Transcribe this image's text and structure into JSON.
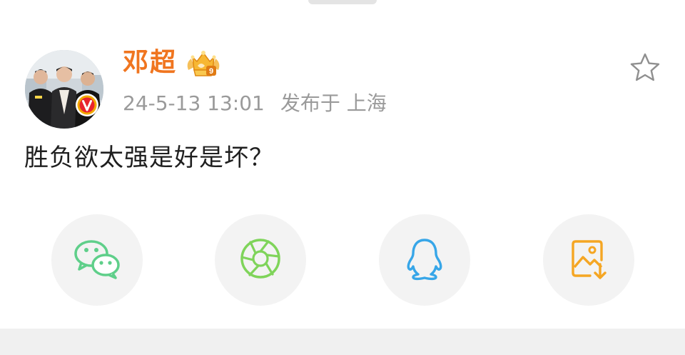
{
  "post": {
    "author": {
      "name": "邓超",
      "verified_badge": "V"
    },
    "time": "24-5-13 13:01",
    "location": "发布于 上海",
    "content": "胜负欲太强是好是坏？"
  },
  "icons": {
    "favorite": "star-outline-icon",
    "level_badge": "crown-level-9-icon",
    "share": [
      "wechat-icon",
      "wechat-moments-icon",
      "qq-icon",
      "save-image-icon"
    ]
  },
  "colors": {
    "name": "#f0751f",
    "meta": "#9a9a9a",
    "text": "#1f1f1f",
    "wechat": "#5fcf8a",
    "moments": "#7fd45a",
    "qq": "#37a6e8",
    "save": "#f5a623",
    "verified": "#f2a900"
  }
}
